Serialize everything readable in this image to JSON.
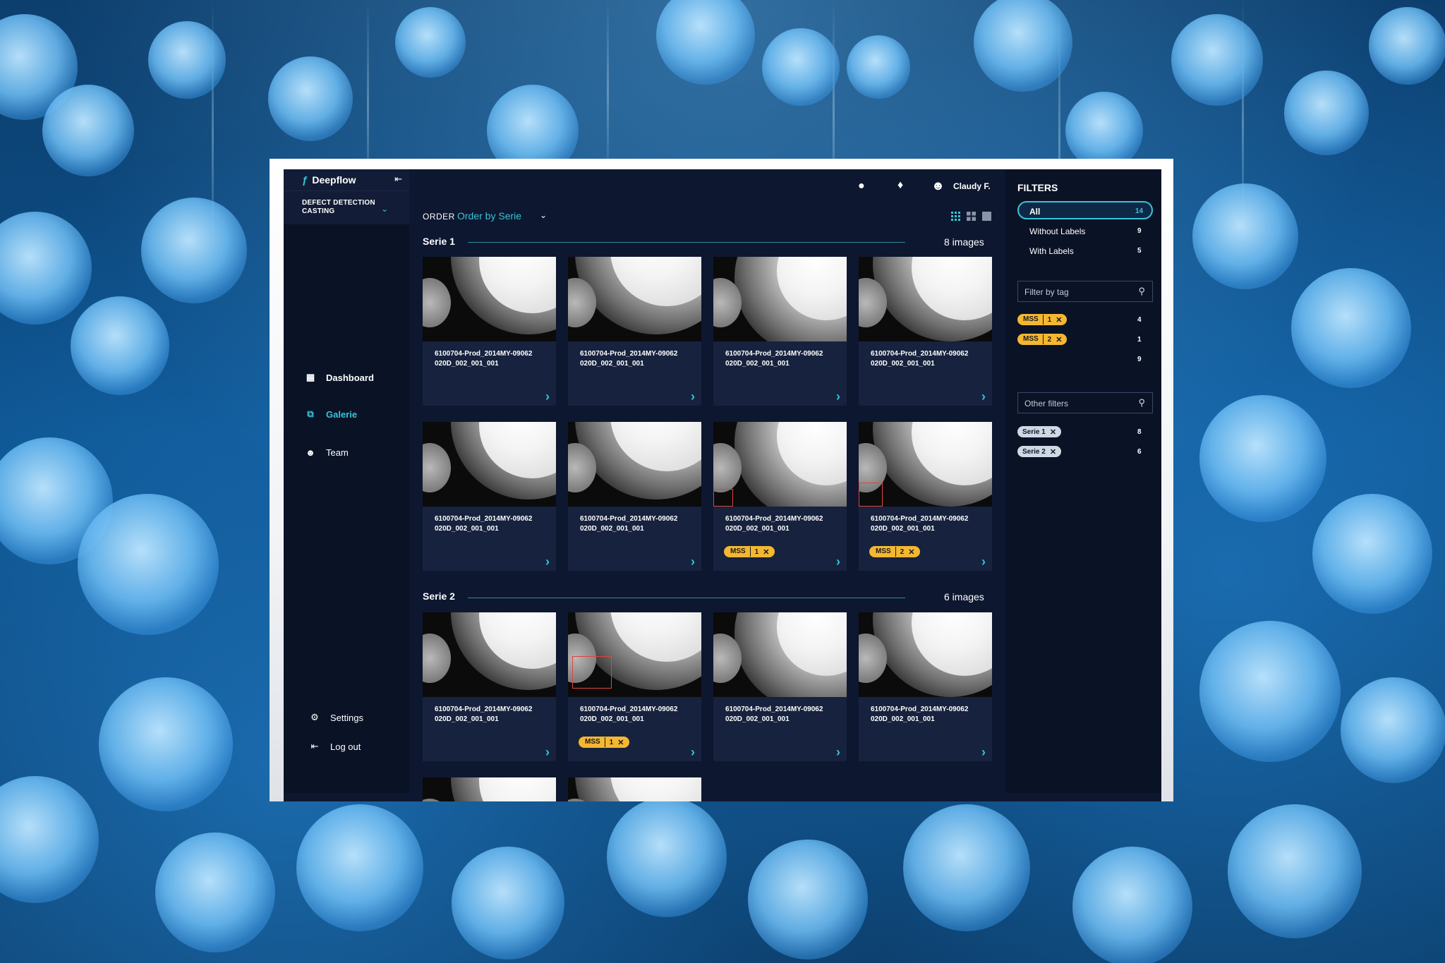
{
  "app": {
    "brand": "Deepflow",
    "project": "DEFECT DETECTION CASTING"
  },
  "sidebar": {
    "items": [
      {
        "label": "Dashboard",
        "icon": "grid-icon"
      },
      {
        "label": "Galerie",
        "icon": "gallery-icon"
      },
      {
        "label": "Team",
        "icon": "user-icon"
      }
    ],
    "footer": [
      {
        "label": "Settings",
        "icon": "gear-icon"
      },
      {
        "label": "Log out",
        "icon": "logout-icon"
      }
    ]
  },
  "header": {
    "user": "Claudy F."
  },
  "toolbar": {
    "order_label": "ORDER",
    "order_value": "Order by Serie"
  },
  "sections": [
    {
      "title": "Serie 1",
      "count": "8 images",
      "cards": [
        {
          "name": "6100704-Prod_2014MY-09062 020D_002_001_001"
        },
        {
          "name": "6100704-Prod_2014MY-09062 020D_002_001_001"
        },
        {
          "name": "6100704-Prod_2014MY-09062 020D_002_001_001"
        },
        {
          "name": "6100704-Prod_2014MY-09062 020D_002_001_001"
        },
        {
          "name": "6100704-Prod_2014MY-09062 020D_002_001_001"
        },
        {
          "name": "6100704-Prod_2014MY-09062 020D_002_001_001"
        },
        {
          "name": "6100704-Prod_2014MY-09062 020D_002_001_001",
          "tag": {
            "name": "MSS",
            "num": "1"
          }
        },
        {
          "name": "6100704-Prod_2014MY-09062 020D_002_001_001",
          "tag": {
            "name": "MSS",
            "num": "2"
          }
        }
      ]
    },
    {
      "title": "Serie 2",
      "count": "6 images",
      "cards": [
        {
          "name": "6100704-Prod_2014MY-09062 020D_002_001_001"
        },
        {
          "name": "6100704-Prod_2014MY-09062 020D_002_001_001",
          "tag": {
            "name": "MSS",
            "num": "1"
          }
        },
        {
          "name": "6100704-Prod_2014MY-09062 020D_002_001_001"
        },
        {
          "name": "6100704-Prod_2014MY-09062 020D_002_001_001"
        }
      ]
    }
  ],
  "filters": {
    "title": "FILTERS",
    "options": [
      {
        "label": "All",
        "count": "14"
      },
      {
        "label": "Without Labels",
        "count": "9"
      },
      {
        "label": "With Labels",
        "count": "5"
      }
    ],
    "tag_placeholder": "Filter by tag",
    "tag_rows": [
      {
        "name": "MSS",
        "num": "1",
        "count": "4"
      },
      {
        "name": "MSS",
        "num": "2",
        "count": "1"
      },
      {
        "count": "9"
      }
    ],
    "other_placeholder": "Other filters",
    "other_rows": [
      {
        "name": "Serie 1",
        "count": "8"
      },
      {
        "name": "Serie 2",
        "count": "6"
      }
    ]
  },
  "colors": {
    "accent": "#35c6d6",
    "tag": "#f4b731",
    "panel": "#0e1730",
    "sidebar": "#0a1226"
  }
}
